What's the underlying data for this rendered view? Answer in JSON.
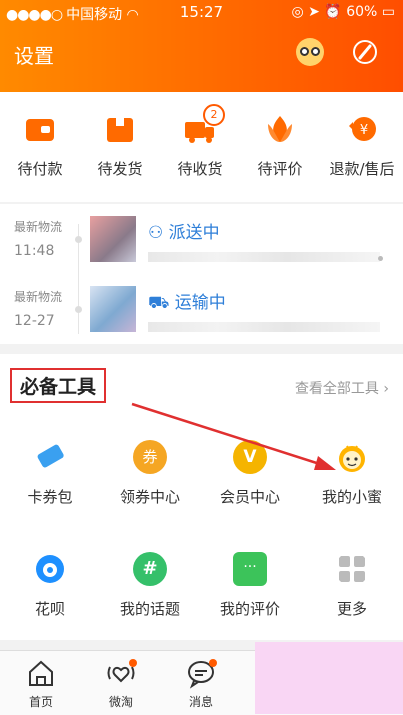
{
  "status_bar": {
    "carrier": "中国移动",
    "time": "15:27",
    "battery": "60%"
  },
  "header": {
    "title": "设置"
  },
  "orders": [
    {
      "label": "待付款",
      "icon": "wallet-icon"
    },
    {
      "label": "待发货",
      "icon": "package-icon"
    },
    {
      "label": "待收货",
      "icon": "truck-icon",
      "badge": "2"
    },
    {
      "label": "待评价",
      "icon": "flower-icon"
    },
    {
      "label": "退款/售后",
      "icon": "refund-icon"
    }
  ],
  "logistics": [
    {
      "label": "最新物流",
      "time": "11:48",
      "status": "派送中"
    },
    {
      "label": "最新物流",
      "time": "12-27",
      "status": "运输中"
    }
  ],
  "tools": {
    "title": "必备工具",
    "view_all": "查看全部工具",
    "items": [
      {
        "label": "卡券包",
        "icon": "ticket-icon",
        "color": "#3aa0f0"
      },
      {
        "label": "领券中心",
        "icon": "coupon-icon",
        "color": "#f5a623",
        "glyph": "券"
      },
      {
        "label": "会员中心",
        "icon": "vip-icon",
        "color": "#f5b400",
        "glyph": "V"
      },
      {
        "label": "我的小蜜",
        "icon": "bee-assistant-icon",
        "color": "#ffb400"
      },
      {
        "label": "花呗",
        "icon": "huabei-icon",
        "color": "#1e90ff"
      },
      {
        "label": "我的话题",
        "icon": "topic-icon",
        "color": "#35c06a",
        "glyph": "#"
      },
      {
        "label": "我的评价",
        "icon": "comment-icon",
        "color": "#3cc35a",
        "glyph": "···"
      },
      {
        "label": "更多",
        "icon": "grid-icon",
        "color": "#bbbbbb"
      }
    ]
  },
  "tabbar": [
    {
      "label": "首页",
      "icon": "home-icon"
    },
    {
      "label": "微淘",
      "icon": "heart-waves-icon",
      "dot": true
    },
    {
      "label": "消息",
      "icon": "message-icon",
      "dot": true
    }
  ],
  "colors": {
    "brand": "#ff6a00",
    "link_blue": "#2f7fd8",
    "annotation_red": "#e03030"
  }
}
